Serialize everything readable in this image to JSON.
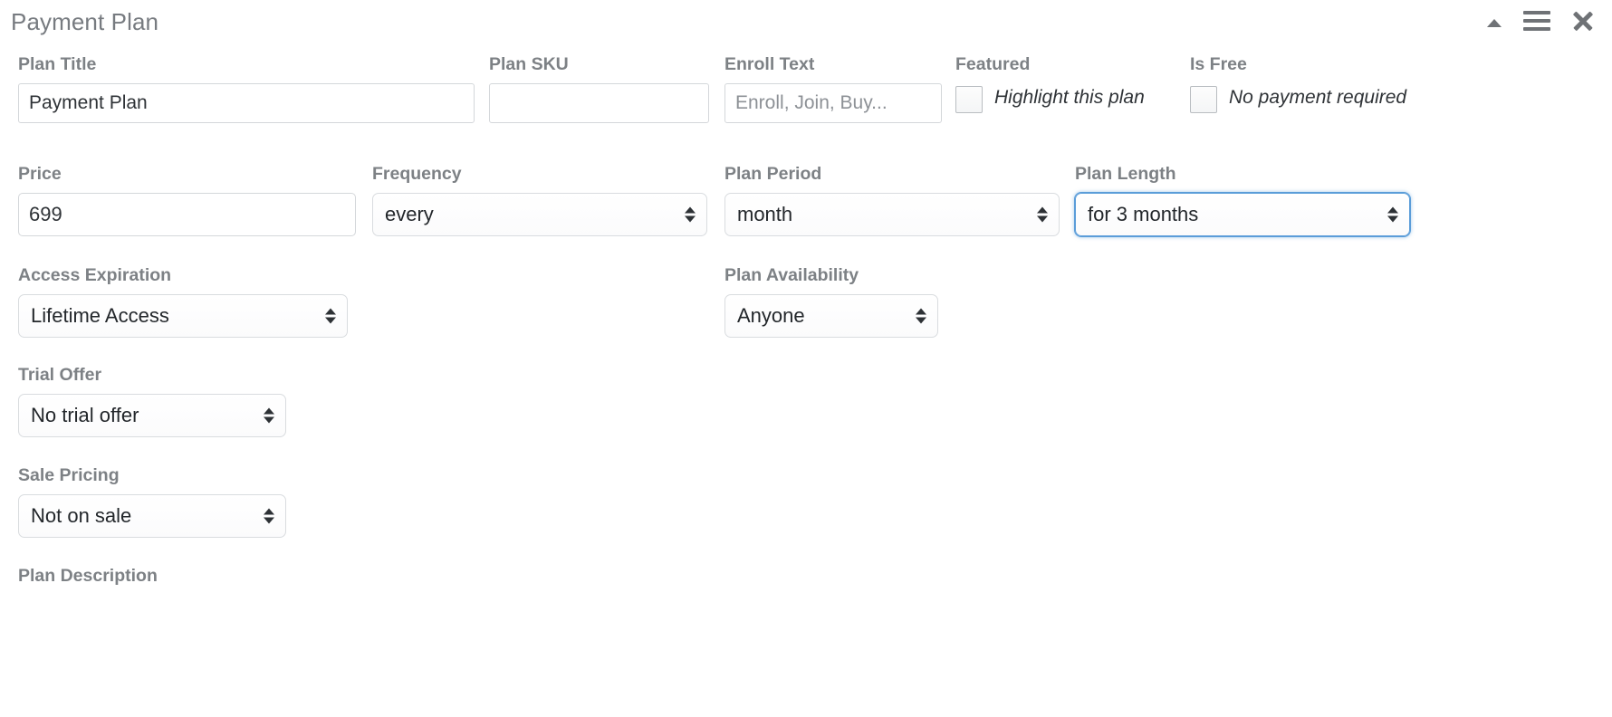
{
  "header": {
    "title": "Payment Plan",
    "icons": {
      "collapse": "collapse-triangle-icon",
      "menu": "hamburger-menu-icon",
      "close": "close-icon"
    }
  },
  "form": {
    "plan_title": {
      "label": "Plan Title",
      "value": "Payment Plan",
      "placeholder": ""
    },
    "plan_sku": {
      "label": "Plan SKU",
      "value": "",
      "placeholder": ""
    },
    "enroll_text": {
      "label": "Enroll Text",
      "value": "",
      "placeholder": "Enroll, Join, Buy..."
    },
    "featured": {
      "label": "Featured",
      "checkbox_label": "Highlight this plan",
      "checked": false
    },
    "is_free": {
      "label": "Is Free",
      "checkbox_label": "No payment required",
      "checked": false
    },
    "price": {
      "label": "Price",
      "value": "699",
      "placeholder": ""
    },
    "frequency": {
      "label": "Frequency",
      "value": "every"
    },
    "plan_period": {
      "label": "Plan Period",
      "value": "month"
    },
    "plan_length": {
      "label": "Plan Length",
      "value": "for 3 months",
      "focused": true
    },
    "access_expiration": {
      "label": "Access Expiration",
      "value": "Lifetime Access"
    },
    "plan_availability": {
      "label": "Plan Availability",
      "value": "Anyone"
    },
    "trial_offer": {
      "label": "Trial Offer",
      "value": "No trial offer"
    },
    "sale_pricing": {
      "label": "Sale Pricing",
      "value": "Not on sale"
    },
    "plan_description": {
      "label": "Plan Description"
    }
  },
  "colors": {
    "label": "#7d8185",
    "title": "#777b80",
    "text": "#2f3337",
    "border": "#d4d7da",
    "focus": "#5b9dd9"
  }
}
